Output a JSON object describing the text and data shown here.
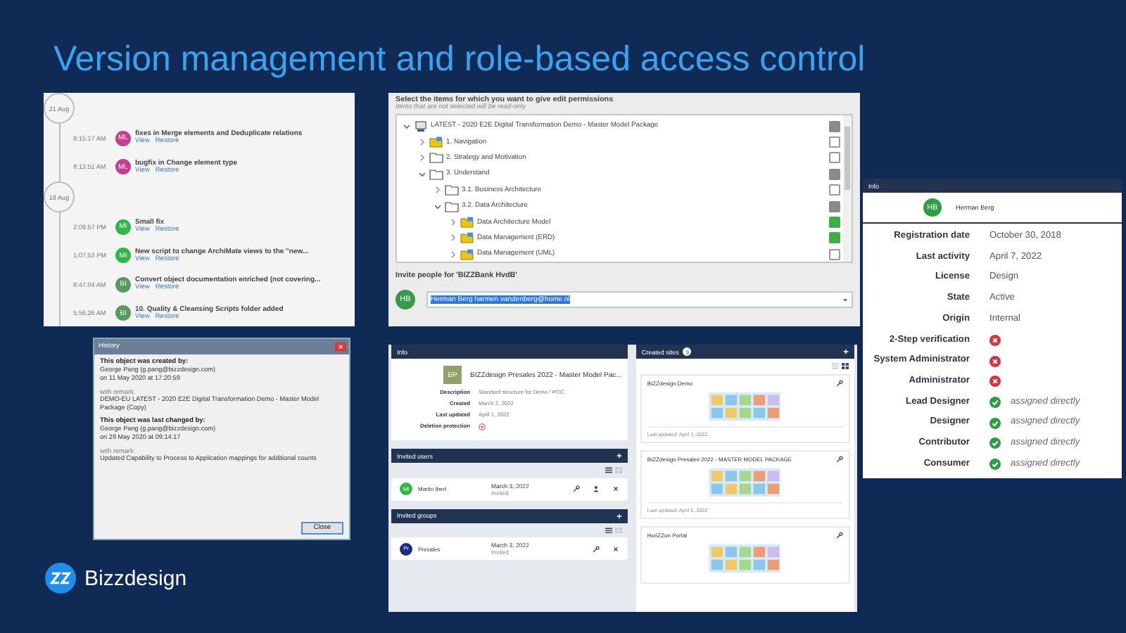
{
  "slide": {
    "title": "Version management and role-based access control"
  },
  "timeline": {
    "groups": [
      {
        "date": "21 Aug",
        "entries": [
          {
            "time": "8:15:17 AM",
            "initials": "ML",
            "color": "#c2408f",
            "message": "fixes in Merge elements and Deduplicate relations",
            "links": [
              "View",
              "Restore"
            ]
          },
          {
            "time": "8:13:51 AM",
            "initials": "ML",
            "color": "#c2408f",
            "message": "bugfix in Change element type",
            "links": [
              "View",
              "Restore"
            ]
          }
        ]
      },
      {
        "date": "19 Aug",
        "entries": [
          {
            "time": "2:09:57 PM",
            "initials": "MI",
            "color": "#2fb84a",
            "message": "Small fix",
            "links": [
              "View",
              "Restore"
            ]
          },
          {
            "time": "1:07:53 PM",
            "initials": "MI",
            "color": "#2fb84a",
            "message": "New script to change ArchiMate views to the \"new...",
            "links": [
              "View",
              "Restore"
            ]
          },
          {
            "time": "8:47:04 AM",
            "initials": "BI",
            "color": "#5a9a5e",
            "message": "Convert object documentation enriched (not covering...",
            "links": [
              "View",
              "Restore"
            ]
          },
          {
            "time": "5:56:26 AM",
            "initials": "BI",
            "color": "#5a9a5e",
            "message": "10. Quality & Cleansing Scripts folder added",
            "links": [
              "View",
              "Restore"
            ]
          }
        ]
      }
    ]
  },
  "permissions": {
    "title": "Select the items for which you want to give edit permissions",
    "subtitle": "Items that are not selected will be read-only",
    "tree": [
      {
        "label": "LATEST - 2020 E2E Digital Transformation Demo - Master Model Package",
        "kind": "package",
        "expanded": true,
        "checked": false,
        "partial": true,
        "children": [
          {
            "label": "1. Navigation",
            "kind": "model",
            "expanded": false,
            "checked": false,
            "partial": false
          },
          {
            "label": "2. Strategy and Motivation",
            "kind": "folder",
            "expanded": false,
            "checked": false,
            "partial": false
          },
          {
            "label": "3. Understand",
            "kind": "folder",
            "expanded": true,
            "checked": false,
            "partial": true,
            "children": [
              {
                "label": "3.1. Business Architecture",
                "kind": "folder",
                "expanded": false,
                "checked": false,
                "partial": false
              },
              {
                "label": "3.2. Data Architecture",
                "kind": "folder",
                "expanded": true,
                "checked": false,
                "partial": true,
                "children": [
                  {
                    "label": "Data Architecture Model",
                    "kind": "model",
                    "expanded": false,
                    "checked": true
                  },
                  {
                    "label": "Data Management (ERD)",
                    "kind": "model",
                    "expanded": false,
                    "checked": true
                  },
                  {
                    "label": "Data Management (UML)",
                    "kind": "model",
                    "expanded": false,
                    "checked": false,
                    "partial": false
                  }
                ]
              }
            ]
          }
        ]
      }
    ],
    "invite_label": "Invite people for 'BIZZBank HvdB'",
    "invite_initials": "HB",
    "invite_value": "Herman Berg harmen.vandenberg@home.nl"
  },
  "user_info": {
    "header": "Info",
    "initials": "HB",
    "name": "Herman Berg",
    "rows": [
      {
        "label": "Registration date",
        "kind": "text",
        "value": "October 30, 2018"
      },
      {
        "label": "Last activity",
        "kind": "text",
        "value": "April 7, 2022"
      },
      {
        "label": "License",
        "kind": "text",
        "value": "Design"
      },
      {
        "label": "State",
        "kind": "text",
        "value": "Active"
      },
      {
        "label": "Origin",
        "kind": "text",
        "value": "Internal"
      },
      {
        "label": "2-Step verification",
        "kind": "flag",
        "on": false
      },
      {
        "label": "System Administrator",
        "kind": "flag",
        "on": false
      },
      {
        "label": "Administrator",
        "kind": "flag",
        "on": false
      },
      {
        "label": "Lead Designer",
        "kind": "flag",
        "on": true,
        "note": "assigned directly"
      },
      {
        "label": "Designer",
        "kind": "flag",
        "on": true,
        "note": "assigned directly"
      },
      {
        "label": "Contributor",
        "kind": "flag",
        "on": true,
        "note": "assigned directly"
      },
      {
        "label": "Consumer",
        "kind": "flag",
        "on": true,
        "note": "assigned directly"
      }
    ]
  },
  "history_dialog": {
    "title": "History",
    "sections": [
      {
        "heading": "This object was created by:",
        "lines": [
          "George Pang (g.pang@bizzdesign.com)",
          "on 11 May 2020 at 17:20:59"
        ],
        "remark_label": "with remark:",
        "remark": "DEMO-EU LATEST - 2020 E2E Digital Transformation Demo - Master Model Package (Copy)"
      },
      {
        "heading": "This object was last changed by:",
        "lines": [
          "George Pang (g.pang@bizzdesign.com)",
          "on 29 May 2020 at 09:14:17"
        ],
        "remark_label": "with remark:",
        "remark": "Updated Capability to Process to Application mappings for additional counts"
      }
    ],
    "button": "Close"
  },
  "portal": {
    "info": {
      "header": "Info",
      "thumb": "BP",
      "title": "BIZZdesign Presales 2022 - Master Model Pac...",
      "fields": [
        {
          "label": "Description",
          "kind": "text",
          "value": "Standard structure for Demo / POC"
        },
        {
          "label": "Created",
          "kind": "text",
          "value": "March 2, 2022"
        },
        {
          "label": "Last updated",
          "kind": "text",
          "value": "April 1, 2022"
        },
        {
          "label": "Deletion protection",
          "kind": "flag",
          "on": false
        }
      ]
    },
    "invited_users": {
      "header": "Invited users",
      "grid_view": false,
      "rows": [
        {
          "kind": "user",
          "initials": "MI",
          "color": "#2fb84a",
          "name": "Martin Ibert",
          "date": "March 3, 2022",
          "status": "Invited"
        }
      ]
    },
    "invited_groups": {
      "header": "Invited groups",
      "grid_view": false,
      "rows": [
        {
          "kind": "group",
          "initials": "Pr",
          "color": "#1d2a80",
          "name": "Presales",
          "date": "March 3, 2022",
          "status": "Invited"
        }
      ]
    },
    "sites": {
      "header": "Created sites",
      "count": "3",
      "grid_view": true,
      "items": [
        {
          "name": "BIZZdesign Demo",
          "updated": "Last updated: April 1, 2022"
        },
        {
          "name": "BIZZdesign Presales 2022 - MASTER MODEL PACKAGE",
          "updated": "Last updated: April 1, 2022"
        },
        {
          "name": "HoriZZon Portal"
        }
      ]
    }
  },
  "logo": {
    "name": "Bizzdesign"
  }
}
